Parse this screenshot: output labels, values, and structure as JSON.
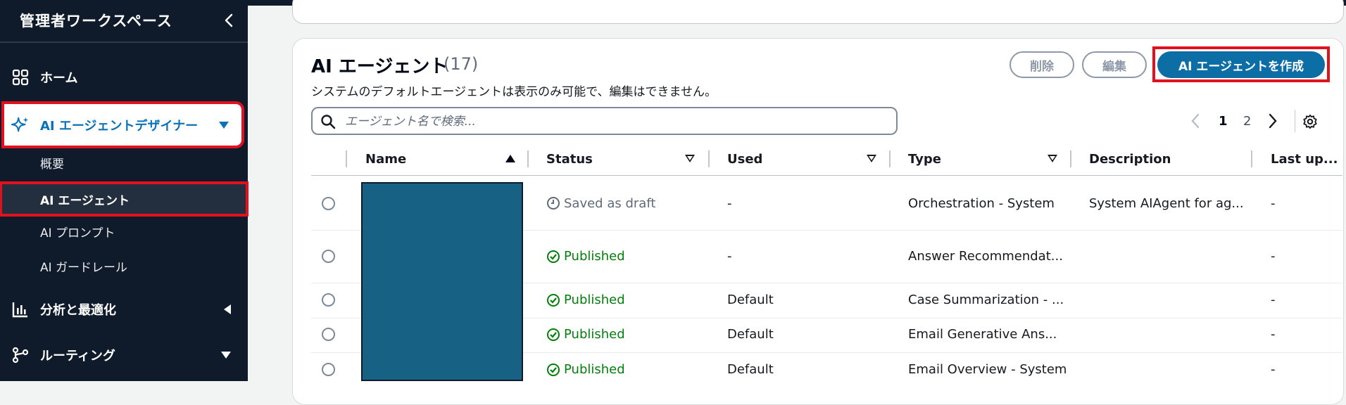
{
  "sidebar": {
    "workspace_title": "管理者ワークスペース",
    "items": [
      {
        "label": "ホーム",
        "icon": "home-grid-icon"
      },
      {
        "label": "AI エージェントデザイナー",
        "icon": "sparkle-icon"
      },
      {
        "label": "分析と最適化",
        "icon": "bar-chart-icon"
      },
      {
        "label": "ルーティング",
        "icon": "routing-icon"
      }
    ],
    "subitems": [
      "概要",
      "AI エージェント",
      "AI プロンプト",
      "AI ガードレール"
    ]
  },
  "card": {
    "title": "AI エージェント",
    "count": "(17)",
    "description": "システムのデフォルトエージェントは表示のみ可能で、編集はできません。",
    "buttons": {
      "delete": "削除",
      "edit": "編集",
      "create": "AI エージェントを作成"
    },
    "search_placeholder": "エージェント名で検索...",
    "pager": {
      "pages": [
        "1",
        "2"
      ],
      "current": "1"
    }
  },
  "table": {
    "columns": [
      "Name",
      "Status",
      "Used",
      "Type",
      "Description",
      "Last up..."
    ],
    "rows": [
      {
        "status": "Saved as draft",
        "used": "-",
        "type": "Orchestration - System",
        "description": "System AIAgent for ag...",
        "last": "-"
      },
      {
        "status": "Published",
        "used": "-",
        "type": "Answer Recommendat...",
        "description": "",
        "last": "-"
      },
      {
        "status": "Published",
        "used": "Default",
        "type": "Case Summarization - ...",
        "description": "",
        "last": "-"
      },
      {
        "status": "Published",
        "used": "Default",
        "type": "Email Generative Ans...",
        "description": "",
        "last": "-"
      },
      {
        "status": "Published",
        "used": "Default",
        "type": "Email Overview - System",
        "description": "",
        "last": "-"
      }
    ]
  },
  "colors": {
    "sidebar_bg": "#0f1b2a",
    "accent": "#0972b8",
    "primary_button": "#0d6ea6",
    "published": "#037f0c",
    "highlight": "#e3101d",
    "redaction": "#176185"
  }
}
